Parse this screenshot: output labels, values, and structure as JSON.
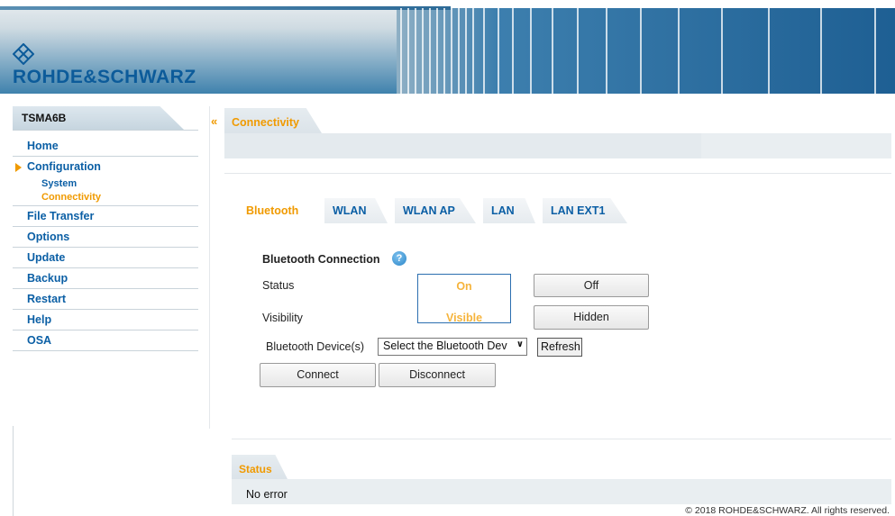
{
  "brand": {
    "wordmark": "ROHDE&SCHWARZ"
  },
  "sidebar": {
    "device": "TSMA6B",
    "items": [
      {
        "label": "Home"
      },
      {
        "label": "Configuration",
        "expanded": true
      },
      {
        "label": "System"
      },
      {
        "label": "Connectivity",
        "active": true
      },
      {
        "label": "File Transfer"
      },
      {
        "label": "Options"
      },
      {
        "label": "Update"
      },
      {
        "label": "Backup"
      },
      {
        "label": "Restart"
      },
      {
        "label": "Help"
      },
      {
        "label": "OSA"
      }
    ]
  },
  "page": {
    "title": "Connectivity"
  },
  "tabs": [
    {
      "label": "Bluetooth",
      "active": true
    },
    {
      "label": "WLAN"
    },
    {
      "label": "WLAN AP"
    },
    {
      "label": "LAN"
    },
    {
      "label": "LAN EXT1"
    }
  ],
  "bluetooth": {
    "section_title": "Bluetooth Connection",
    "help_icon": "?",
    "status_label": "Status",
    "status_on": "On",
    "status_off": "Off",
    "visibility_label": "Visibility",
    "visibility_visible": "Visible",
    "visibility_hidden": "Hidden",
    "device_label": "Bluetooth Device(s)",
    "device_select": "Select the Bluetooth Dev",
    "refresh": "Refresh",
    "connect": "Connect",
    "disconnect": "Disconnect"
  },
  "status": {
    "title": "Status",
    "message": "No error"
  },
  "footer": {
    "copyright": "© 2018 ROHDE&SCHWARZ. All rights reserved."
  },
  "colors": {
    "accent": "#f09a00",
    "link": "#0b5fa5",
    "brand": "#0c5b9a"
  }
}
